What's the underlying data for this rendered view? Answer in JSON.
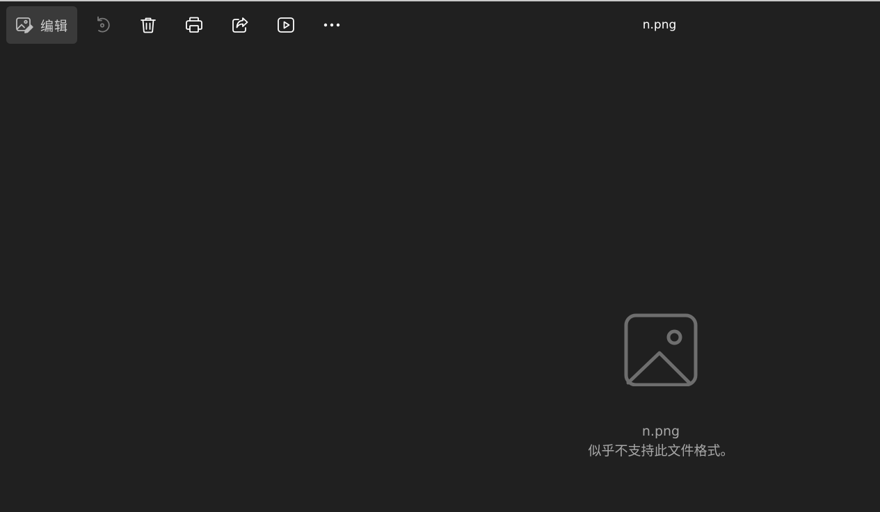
{
  "toolbar": {
    "edit_label": "编辑",
    "icons": [
      "edit-image-icon",
      "rotate-icon",
      "delete-icon",
      "print-icon",
      "share-icon",
      "slideshow-icon",
      "more-icon"
    ]
  },
  "title": {
    "filename": "n.png"
  },
  "viewer": {
    "placeholder_icon": "image-placeholder-icon",
    "filename": "n.png",
    "message": "似乎不支持此文件格式。"
  },
  "colors": {
    "background": "#202020",
    "toolbar_button_active": "#3a3a3a",
    "icon_default": "#ffffff",
    "icon_disabled": "#7a7a7a",
    "placeholder_text": "#a8a8a8"
  }
}
